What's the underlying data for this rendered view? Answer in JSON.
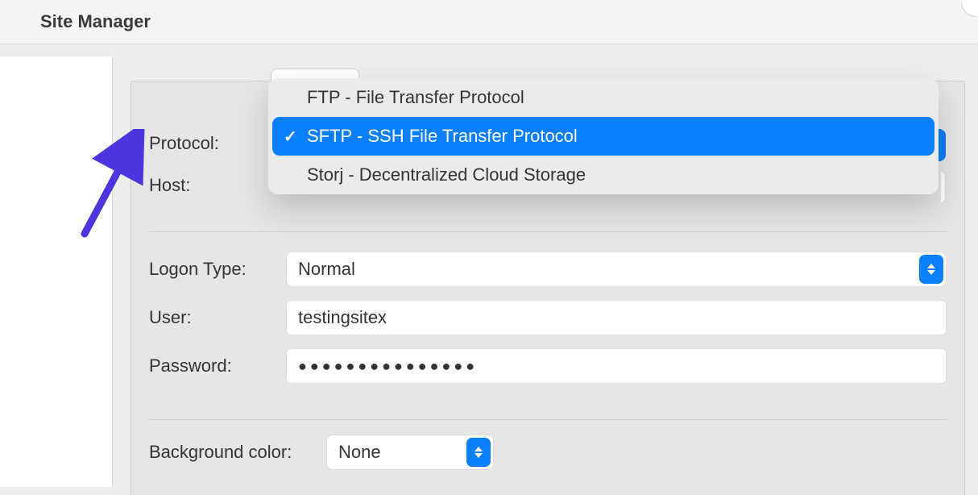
{
  "window": {
    "title": "Site Manager"
  },
  "form": {
    "protocol_label": "Protocol:",
    "host_label": "Host:",
    "logon_label": "Logon Type:",
    "logon_value": "Normal",
    "user_label": "User:",
    "user_value": "testingsitex",
    "password_label": "Password:",
    "password_masked": "●●●●●●●●●●●●●●●",
    "bgcolor_label": "Background color:",
    "bgcolor_value": "None"
  },
  "protocol_dropdown": {
    "options": [
      "FTP - File Transfer Protocol",
      "SFTP - SSH File Transfer Protocol",
      "Storj - Decentralized Cloud Storage"
    ],
    "selected_index": 1
  },
  "colors": {
    "accent": "#0a7fff",
    "arrow": "#4a35de"
  }
}
